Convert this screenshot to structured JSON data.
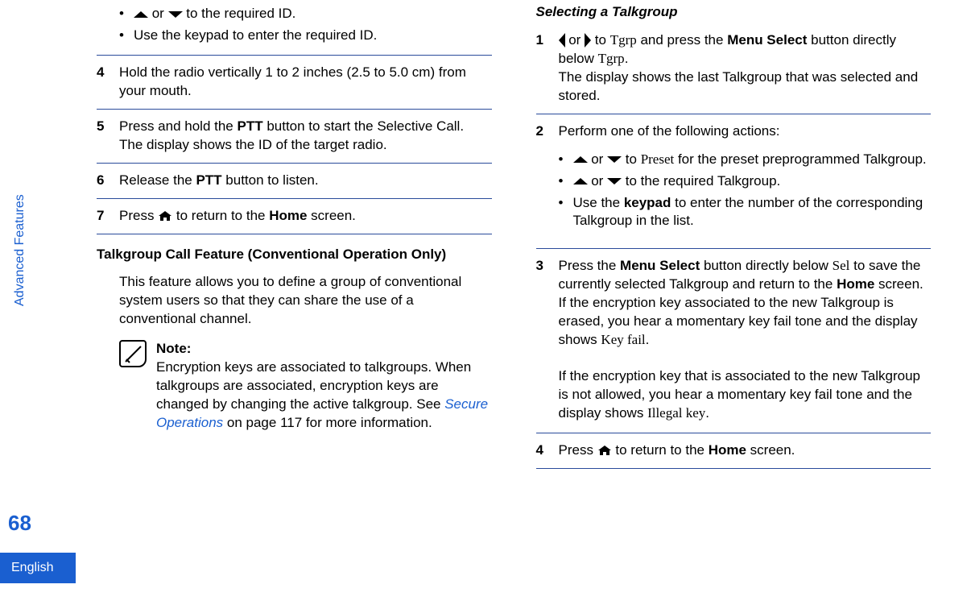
{
  "sideLabel": "Advanced Features",
  "pageNumber": "68",
  "language": "English",
  "left": {
    "bullets1": {
      "b1_pre": "",
      "b1_mid": " or ",
      "b1_post": " to the required ID.",
      "b2": "Use the keypad to enter the required ID."
    },
    "step4": {
      "num": "4",
      "text1": "Hold the radio vertically 1 to 2 inches (2.5 to 5.0 cm) from your mouth."
    },
    "step5": {
      "num": "5",
      "t1a": "Press and hold the ",
      "t1b": "PTT",
      "t1c": " button to start the Selective Call.",
      "t2": "The display shows the ID of the target radio."
    },
    "step6": {
      "num": "6",
      "t1a": "Release the ",
      "t1b": "PTT",
      "t1c": " button to listen."
    },
    "step7": {
      "num": "7",
      "t1a": "Press ",
      "t1b": " to return to the ",
      "t1c": "Home",
      "t1d": " screen."
    },
    "heading": "Talkgroup Call Feature (Conventional Operation Only)",
    "intro": "This feature allows you to define a group of conventional system users so that they can share the use of a conventional channel.",
    "note": {
      "label": "Note:",
      "body1": "Encryption keys are associated to talkgroups. When talkgroups are associated, encryption keys are changed by changing the active talkgroup. See ",
      "link": "Secure Operations",
      "body2": " on page 117 for more information."
    }
  },
  "right": {
    "subheading": "Selecting a Talkgroup",
    "step1": {
      "num": "1",
      "a": " or ",
      "b": " to ",
      "tgrp": "Tgrp",
      "c": " and press the ",
      "ms": "Menu Select",
      "d": " button directly below ",
      "tgrp2": "Tgrp",
      "e": ".",
      "line2": "The display shows the last Talkgroup that was selected and stored."
    },
    "step2": {
      "num": "2",
      "lead": "Perform one of the following actions:",
      "b1_mid": " or ",
      "b1_to": " to ",
      "preset": "Preset",
      "b1_post": " for the preset preprogrammed Talkgroup.",
      "b2_mid": " or ",
      "b2_post": " to the required Talkgroup.",
      "b3a": "Use the ",
      "b3b": "keypad",
      "b3c": " to enter the number of the corresponding Talkgroup in the list."
    },
    "step3": {
      "num": "3",
      "a": "Press the ",
      "ms": "Menu Select",
      "b": " button directly below ",
      "sel": "Sel",
      "c": " to save the currently selected Talkgroup and return to the ",
      "home": "Home",
      "d": " screen.",
      "line2a": "If the encryption key associated to the new Talkgroup is erased, you hear a momentary key fail tone and the display shows ",
      "kf": "Key fail",
      "line2b": ".",
      "line3a": "If the encryption key that is associated to the new Talkgroup is not allowed, you hear a momentary key fail tone and the display shows ",
      "ik": "Illegal key",
      "line3b": "."
    },
    "step4": {
      "num": "4",
      "a": "Press ",
      "b": " to return to the ",
      "home": "Home",
      "c": " screen."
    }
  }
}
